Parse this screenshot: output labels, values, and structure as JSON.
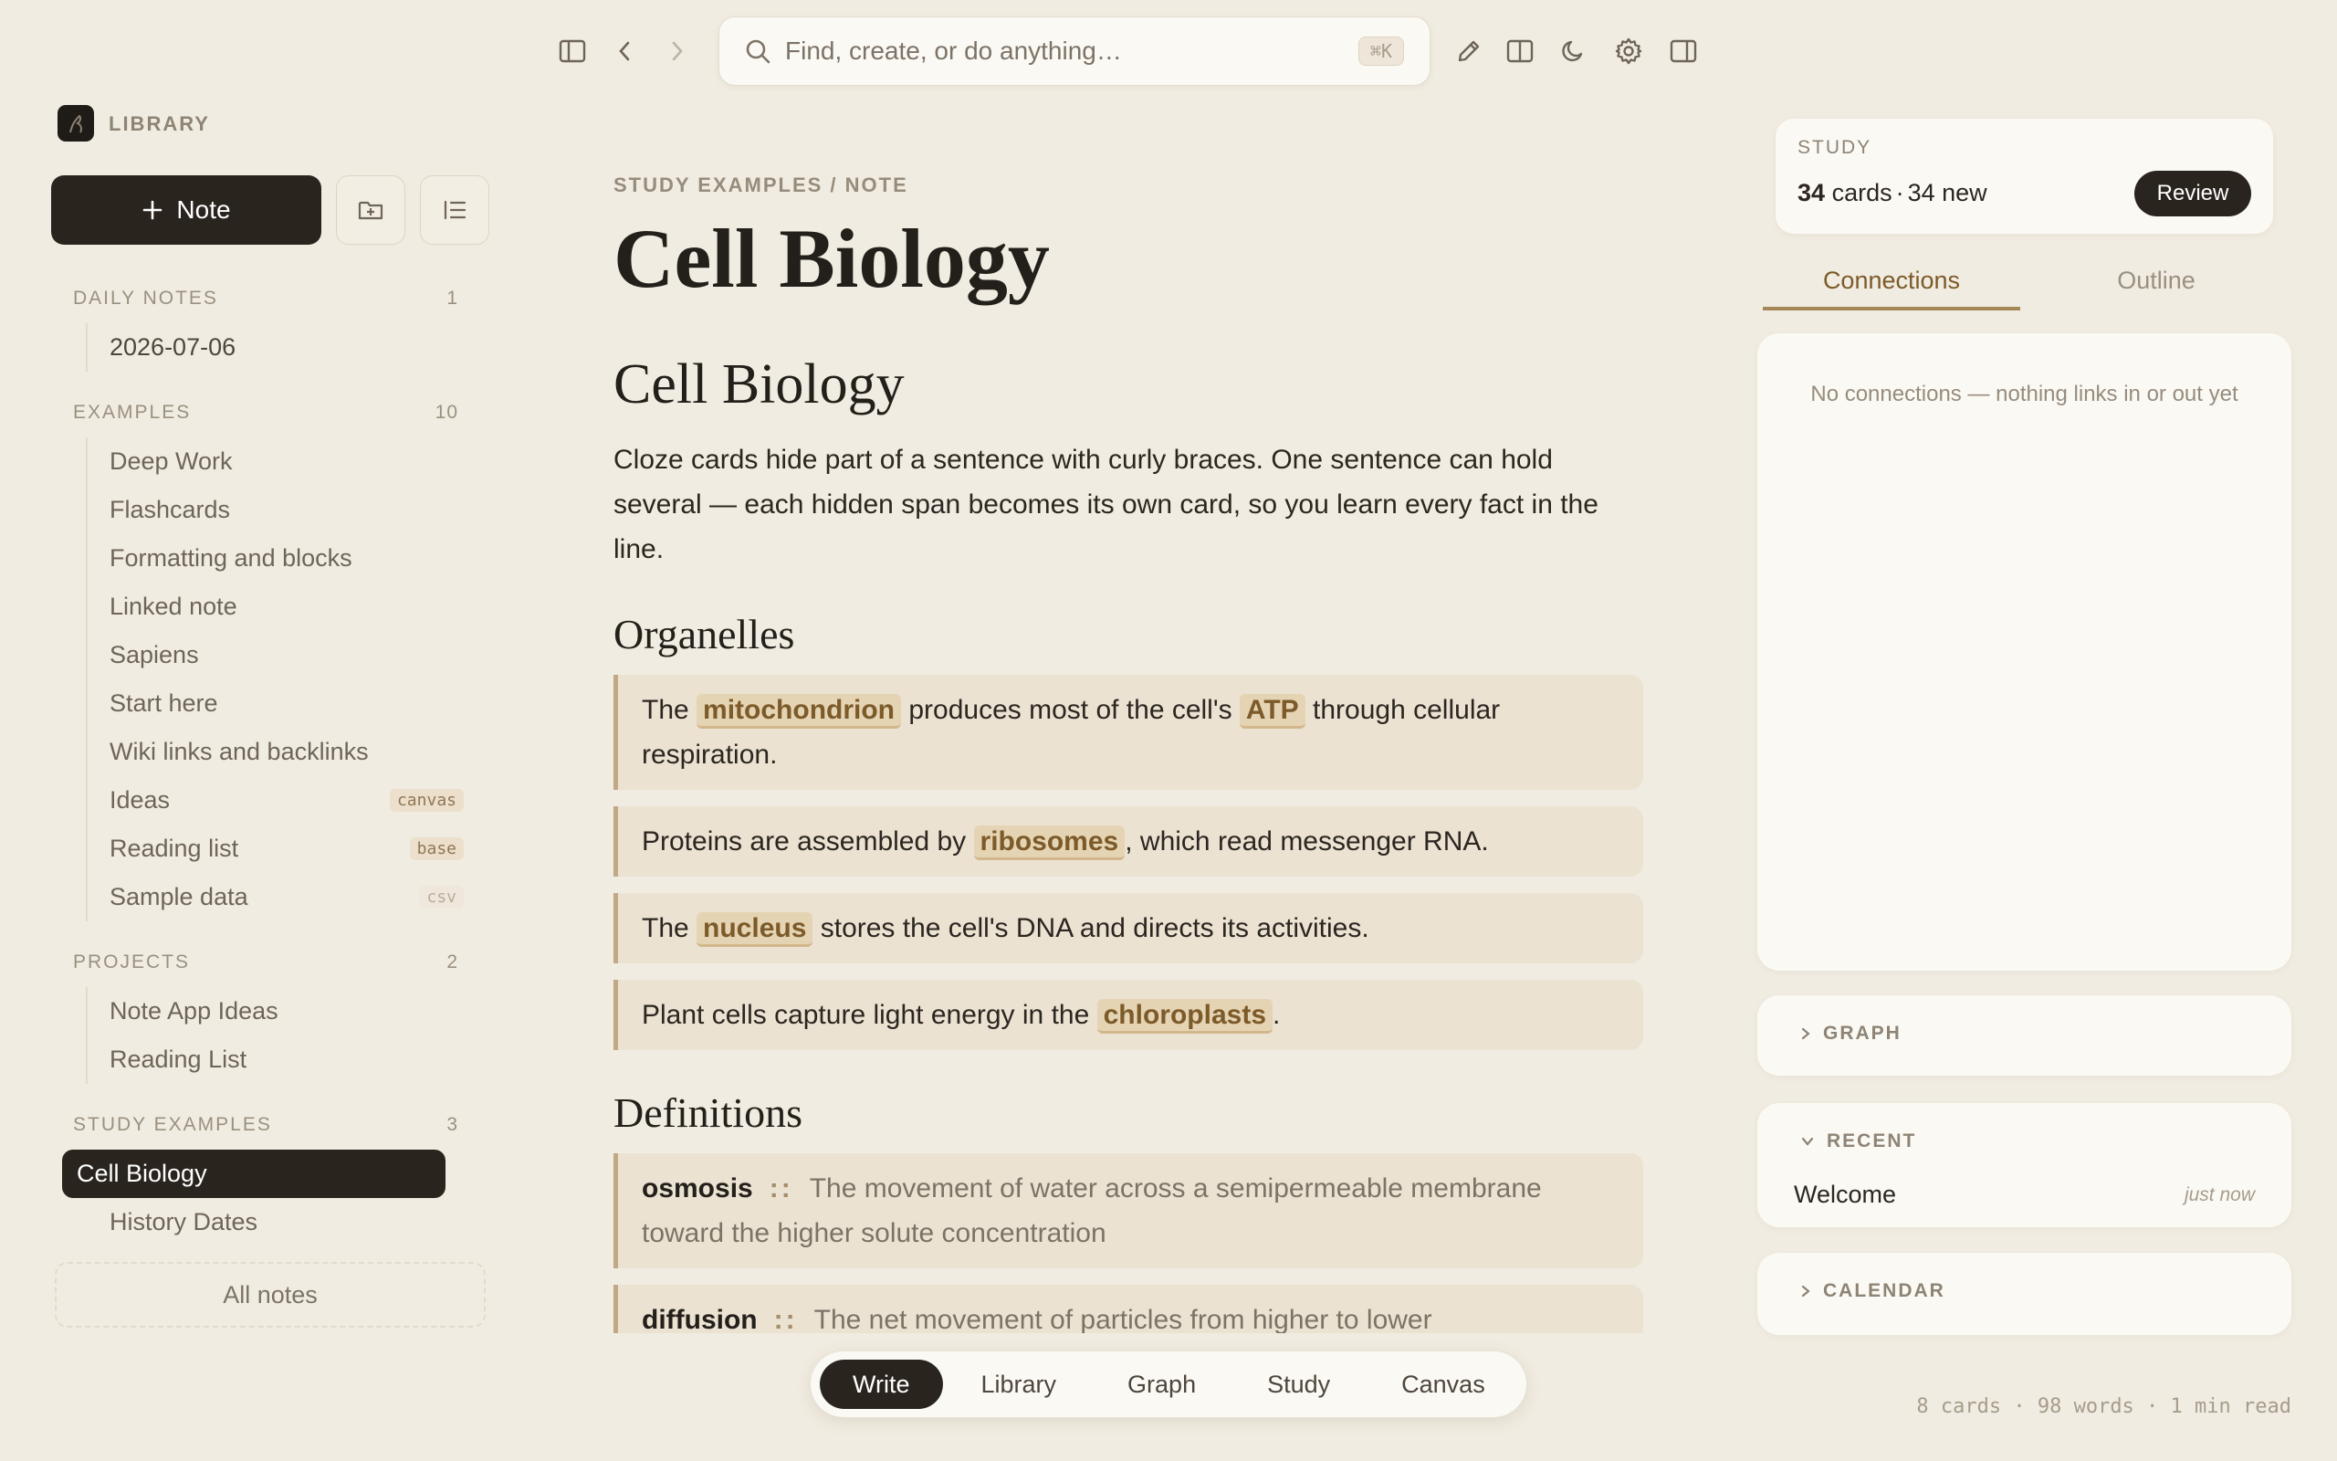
{
  "toolbar": {
    "search_placeholder": "Find, create, or do anything…",
    "search_shortcut": "⌘K"
  },
  "sidebar": {
    "title": "LIBRARY",
    "new_note_label": "Note",
    "sections": [
      {
        "label": "DAILY NOTES",
        "count": "1",
        "items": [
          {
            "label": "2026-07-06"
          }
        ]
      },
      {
        "label": "EXAMPLES",
        "count": "10",
        "items": [
          {
            "label": "Deep Work"
          },
          {
            "label": "Flashcards"
          },
          {
            "label": "Formatting and blocks"
          },
          {
            "label": "Linked note"
          },
          {
            "label": "Sapiens"
          },
          {
            "label": "Start here"
          },
          {
            "label": "Wiki links and backlinks"
          },
          {
            "label": "Ideas",
            "tag": "canvas"
          },
          {
            "label": "Reading list",
            "tag": "base"
          },
          {
            "label": "Sample data",
            "tag": "csv"
          }
        ]
      },
      {
        "label": "PROJECTS",
        "count": "2",
        "items": [
          {
            "label": "Note App Ideas"
          },
          {
            "label": "Reading List"
          }
        ]
      },
      {
        "label": "STUDY EXAMPLES",
        "count": "3",
        "items": [
          {
            "label": "Cell Biology",
            "active": true
          },
          {
            "label": "History Dates"
          }
        ]
      }
    ],
    "all_notes_label": "All notes"
  },
  "editor": {
    "breadcrumb": "STUDY EXAMPLES / NOTE",
    "title": "Cell Biology",
    "heading": "Cell Biology",
    "intro": "Cloze cards hide part of a sentence with curly braces. One sentence can hold several — each hidden span becomes its own card, so you learn every fact in the line.",
    "organelles_heading": "Organelles",
    "cloze_cards": [
      {
        "parts": [
          {
            "t": "The "
          },
          {
            "h": "mitochondrion"
          },
          {
            "t": " produces most of the cell's "
          },
          {
            "h": "ATP"
          },
          {
            "t": " through cellular respiration."
          }
        ]
      },
      {
        "parts": [
          {
            "t": "Proteins are assembled by "
          },
          {
            "h": "ribosomes"
          },
          {
            "t": ", which read messenger RNA."
          }
        ]
      },
      {
        "parts": [
          {
            "t": "The "
          },
          {
            "h": "nucleus"
          },
          {
            "t": " stores the cell's DNA and directs its activities."
          }
        ]
      },
      {
        "parts": [
          {
            "t": "Plant cells capture light energy in the "
          },
          {
            "h": "chloroplasts"
          },
          {
            "t": "."
          }
        ]
      }
    ],
    "definitions_heading": "Definitions",
    "definitions": [
      {
        "term": "osmosis",
        "sep": "::",
        "text": "The movement of water across a semipermeable membrane toward the higher solute concentration"
      },
      {
        "term": "diffusion",
        "sep": "::",
        "text": "The net movement of particles from higher to lower"
      }
    ]
  },
  "dock": {
    "tabs": [
      {
        "label": "Write",
        "active": true
      },
      {
        "label": "Library"
      },
      {
        "label": "Graph"
      },
      {
        "label": "Study"
      },
      {
        "label": "Canvas"
      }
    ]
  },
  "right_panel": {
    "study": {
      "label": "STUDY",
      "cards_count": "34",
      "cards_word": "cards",
      "separator": "·",
      "new_text": "34 new",
      "review_label": "Review"
    },
    "tabs": {
      "connections": "Connections",
      "outline": "Outline"
    },
    "connections_empty": "No connections — nothing links in or out yet",
    "graph_label": "GRAPH",
    "recent_label": "RECENT",
    "recent_item": {
      "name": "Welcome",
      "time": "just now"
    },
    "calendar_label": "CALENDAR"
  },
  "footer": {
    "stats": "8 cards · 98 words · 1 min read"
  }
}
